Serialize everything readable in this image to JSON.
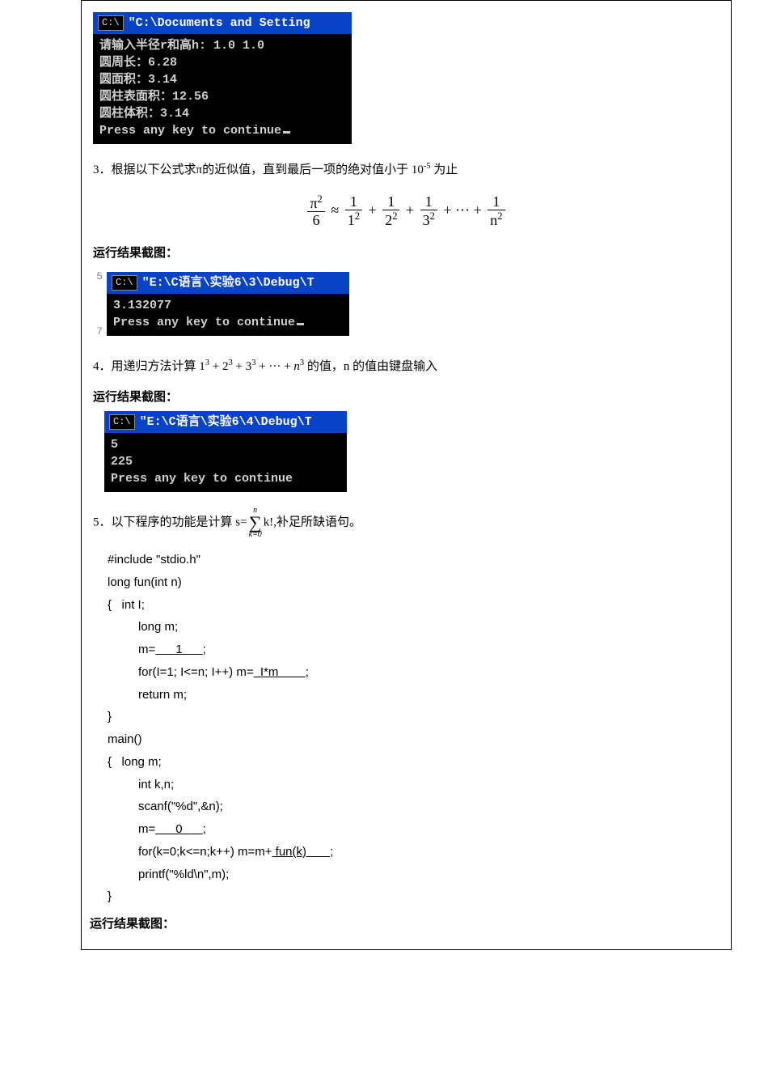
{
  "console1": {
    "title": "\"C:\\Documents and Setting",
    "body": "请输入半径r和高h: 1.0 1.0\n圆周长：6.28\n圆面积：3.14\n圆柱表面积：12.56\n圆柱体积：3.14\nPress any key to continue"
  },
  "prob3": {
    "text_before": "3．根据以下公式求π的近似值，直到最后一项的绝对值小于 ",
    "exp_base": "10",
    "exp_sup": "-5",
    "text_after": " 为止",
    "formula": {
      "lhs_num": "π",
      "lhs_sup": "2",
      "lhs_den": "6",
      "approx": "≈",
      "t1_num": "1",
      "t1_denb": "1",
      "t1_dene": "2",
      "t2_num": "1",
      "t2_denb": "2",
      "t2_dene": "2",
      "t3_num": "1",
      "t3_denb": "3",
      "t3_dene": "2",
      "dots": "···",
      "tn_num": "1",
      "tn_denb": "n",
      "tn_dene": "2"
    },
    "result_label": "运行结果截图："
  },
  "console2": {
    "title": "\"E:\\C语言\\实验6\\3\\Debug\\T",
    "body": "3.132077\nPress any key to continue"
  },
  "prob4": {
    "text_before": "4．用递归方法计算 ",
    "expr_terms": "1³ + 2³ + 3³ + ··· + n³",
    "t1b": "1",
    "t1e": "3",
    "t2b": "2",
    "t2e": "3",
    "t3b": "3",
    "t3e": "3",
    "tnb": "n",
    "tne": "3",
    "text_after": " 的值，n 的值由键盘输入",
    "result_label": "运行结果截图："
  },
  "console3": {
    "title": "\"E:\\C语言\\实验6\\4\\Debug\\T",
    "body": "5\n225\nPress any key to continue"
  },
  "prob5": {
    "text_before": "5．以下程序的功能是计算 s=",
    "sum_top": "n",
    "sum_bot": "k=0",
    "sum_body": "k!,",
    "text_after": "补足所缺语句。"
  },
  "code": {
    "l1": "#include \"stdio.h\"",
    "l2": "long fun(int n)",
    "l3_open": "{",
    "l3_a": "int I;",
    "l4": "long m;",
    "l5_a": "m=",
    "l5_blank": "      1      ",
    "l5_b": ";",
    "l6_a": "for(I=1; I<=n; I++)      m=",
    "l6_blank": "  I*m        ",
    "l6_b": ";",
    "l7": "return m;",
    "l8": "}",
    "l9": "main()",
    "l10_open": "{",
    "l10_a": "long m;",
    "l11": "int k,n;",
    "l12": "scanf(\"%d\",&n);",
    "l13_a": "m=",
    "l13_blank": "      0      ",
    "l13_b": ";",
    "l14_a": "for(k=0;k<=n;k++)    m=m+",
    "l14_blank": " fun(k)       ",
    "l14_b": ";",
    "l15": "printf(\"%ld\\n\",m);",
    "l16": "}"
  },
  "final_result_label": "运行结果截图："
}
